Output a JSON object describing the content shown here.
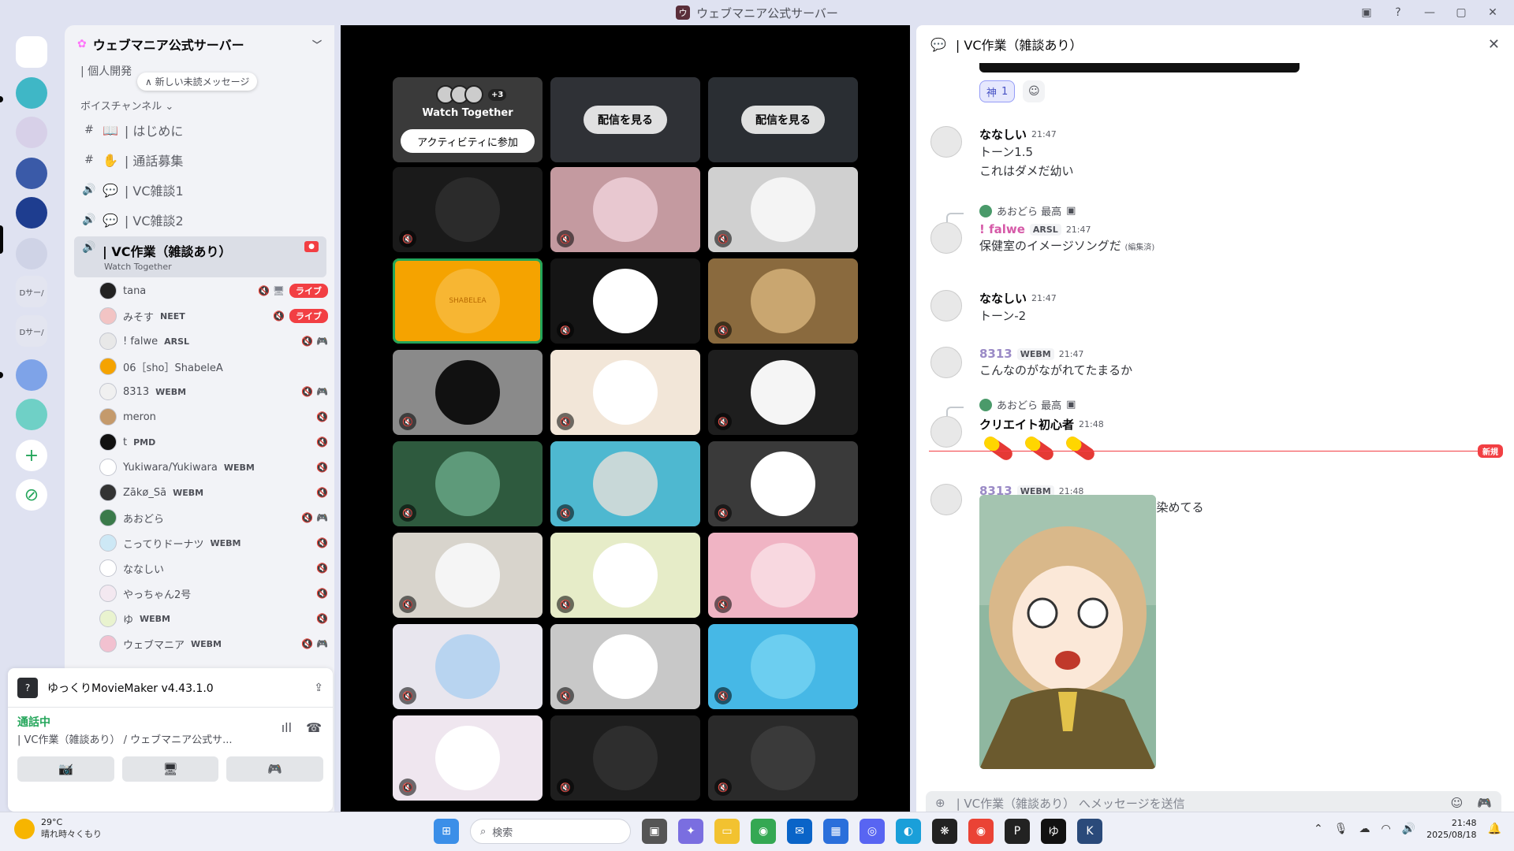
{
  "window": {
    "title": "ウェブマニア公式サーバー",
    "controls": [
      "▣",
      "?",
      "—",
      "▢",
      "✕"
    ]
  },
  "servers": [
    {
      "label": "",
      "type": "discord"
    },
    {
      "label": "",
      "type": "avatar",
      "color": "#3fb7c6"
    },
    {
      "label": "",
      "type": "avatar",
      "color": "#d7d0e8"
    },
    {
      "label": "",
      "type": "avatar",
      "color": "#3a5aa8"
    },
    {
      "label": "",
      "type": "avatar",
      "color": "#1e3d8f"
    },
    {
      "label": "",
      "type": "avatar",
      "color": "#cfd3e6"
    },
    {
      "label": "Dサー/",
      "type": "folder"
    },
    {
      "label": "Dサー/",
      "type": "folder"
    },
    {
      "label": "",
      "type": "avatar",
      "color": "#7ea3e8"
    },
    {
      "label": "",
      "type": "avatar",
      "color": "#6fd0c6"
    },
    {
      "label": "+",
      "type": "add"
    },
    {
      "label": "⊘",
      "type": "discover"
    }
  ],
  "sidebar": {
    "server_name": "ウェブマニア公式サーバー",
    "top_channel": "| 個人開発",
    "new_messages_pill": "∧ 新しい未読メッセージ",
    "category": "ボイスチャンネル",
    "channels": [
      {
        "icon": "#",
        "emoji": "📖",
        "name": "| はじめに"
      },
      {
        "icon": "#",
        "emoji": "✋",
        "name": "| 通話募集"
      },
      {
        "icon": "🔊",
        "emoji": "💬",
        "name": "| VC雑談1"
      },
      {
        "icon": "🔊",
        "emoji": "💬",
        "name": "| VC雑談2"
      }
    ],
    "selected_channel": {
      "icon": "🔊",
      "name": "| VC作業（雑談あり）",
      "sub": "Watch Together"
    },
    "voice_users": [
      {
        "name": "tana",
        "tag": "",
        "live": "ライブ",
        "icons": "🔇 🖥",
        "avatar": "#222"
      },
      {
        "name": "みそす",
        "tag": "NEET",
        "live": "ライブ",
        "icons": "🔇",
        "avatar": "#f2c4c4"
      },
      {
        "name": "! falwe",
        "tag": "ARSL",
        "live": "",
        "icons": "🔇 🎮",
        "avatar": "#e8e8e8"
      },
      {
        "name": "06［sho］ShabeleA",
        "tag": "",
        "live": "",
        "icons": "",
        "avatar": "#f5a300"
      },
      {
        "name": "8313",
        "tag": "WEBM",
        "live": "",
        "icons": "🔇 🎮",
        "avatar": "#f0f0f0"
      },
      {
        "name": "meron",
        "tag": "",
        "live": "",
        "icons": "🔇",
        "avatar": "#c49a6c"
      },
      {
        "name": "t",
        "tag": "PMD",
        "live": "",
        "icons": "🔇",
        "avatar": "#111"
      },
      {
        "name": "Yukiwara/Yukiwara",
        "tag": "WEBM",
        "live": "",
        "icons": "🔇",
        "avatar": "#fff"
      },
      {
        "name": "Zākø_Sā",
        "tag": "WEBM",
        "live": "",
        "icons": "🔇",
        "avatar": "#333"
      },
      {
        "name": "あおどら",
        "tag": "",
        "live": "",
        "icons": "🔇 🎮",
        "avatar": "#3a7a4a"
      },
      {
        "name": "こってりドーナツ",
        "tag": "WEBM",
        "live": "",
        "icons": "🔇",
        "avatar": "#cde8f5"
      },
      {
        "name": "ななしい",
        "tag": "",
        "live": "",
        "icons": "🔇",
        "avatar": "#fff"
      },
      {
        "name": "やっちゃん2号",
        "tag": "",
        "live": "",
        "icons": "🔇",
        "avatar": "#f3e8f0"
      },
      {
        "name": "ゆ",
        "tag": "WEBM",
        "live": "",
        "icons": "🔇",
        "avatar": "#e9f3cf"
      },
      {
        "name": "ウェブマニア",
        "tag": "WEBM",
        "live": "",
        "icons": "🔇 🎮",
        "avatar": "#f2c1d0"
      }
    ]
  },
  "bottom_panel": {
    "activity": "ゆっくりMovieMaker v4.43.1.0",
    "status": "通話中",
    "location": "| VC作業（雑談あり） / ウェブマニア公式サ...",
    "buttons": [
      "📷̸",
      "🖥",
      "🎮"
    ]
  },
  "stage": {
    "watch_together": {
      "title": "Watch Together",
      "more": "+3",
      "button": "アクティビティに参加"
    },
    "stream_button": "配信を見る",
    "tiles": [
      {
        "bg": "#1a1a1a",
        "av": "#2b2b2b",
        "label": ""
      },
      {
        "bg": "#c49aa0",
        "av": "#e8c8d0",
        "label": ""
      },
      {
        "bg": "#d0d0d0",
        "av": "#f4f4f4",
        "label": ""
      },
      {
        "bg": "#f5a300",
        "av": "#f7b633",
        "label": "SHABELEA"
      },
      {
        "bg": "#151515",
        "av": "#ffffff",
        "label": ""
      },
      {
        "bg": "#8a6a3e",
        "av": "#c9a670",
        "label": ""
      },
      {
        "bg": "#8a8a8a",
        "av": "#111111",
        "label": ""
      },
      {
        "bg": "#f2e6d8",
        "av": "#ffffff",
        "label": ""
      },
      {
        "bg": "#1e1e1e",
        "av": "#f5f5f5",
        "label": ""
      },
      {
        "bg": "#2e5a3e",
        "av": "#5e9a7a",
        "label": ""
      },
      {
        "bg": "#4eb8d0",
        "av": "#c8d8d8",
        "label": ""
      },
      {
        "bg": "#3a3a3a",
        "av": "#ffffff",
        "label": ""
      },
      {
        "bg": "#d8d4cc",
        "av": "#f5f5f5",
        "label": ""
      },
      {
        "bg": "#e6ecc8",
        "av": "#ffffff",
        "label": ""
      },
      {
        "bg": "#f0b4c4",
        "av": "#f8d8e0",
        "label": ""
      },
      {
        "bg": "#e8e6ee",
        "av": "#b8d4f0",
        "label": ""
      },
      {
        "bg": "#c8c8c8",
        "av": "#ffffff",
        "label": ""
      },
      {
        "bg": "#46b8e6",
        "av": "#6ccef0",
        "label": ""
      },
      {
        "bg": "#efe6ef",
        "av": "#ffffff",
        "label": ""
      },
      {
        "bg": "#1e1e1e",
        "av": "#2e2e2e",
        "label": ""
      },
      {
        "bg": "#2a2a2a",
        "av": "#3a3a3a",
        "label": ""
      }
    ]
  },
  "chat": {
    "channel": "| VC作業（雑談あり）",
    "reaction": {
      "emoji": "神",
      "count": "1"
    },
    "messages": [
      {
        "name": "ななしい",
        "name_color": "#060607",
        "tag": "",
        "time": "21:47",
        "lines": [
          "トーン1.5",
          "これはダメだ幼い"
        ],
        "reply": ""
      },
      {
        "name": "! falwe",
        "name_color": "#d65aa8",
        "tag": "ARSL",
        "time": "21:47",
        "lines": [
          "保健室のイメージソングだ"
        ],
        "edited": "(編集済)",
        "reply": "あおどら 最高"
      },
      {
        "name": "ななしい",
        "name_color": "#060607",
        "tag": "",
        "time": "21:47",
        "lines": [
          "トーン-2"
        ],
        "reply": ""
      },
      {
        "name": "8313",
        "name_color": "#9a8ac6",
        "tag": "WEBM",
        "time": "21:47",
        "lines": [
          "こんなのがながれてたまるか"
        ],
        "reply": ""
      },
      {
        "name": "クリエイト初心者",
        "name_color": "#060607",
        "tag": "",
        "time": "21:48",
        "lines": [
          ""
        ],
        "reply": "あおどら 最高"
      },
      {
        "name": "8313",
        "name_color": "#9a8ac6",
        "tag": "WEBM",
        "time": "21:48",
        "lines": [
          "ミックルさんいつの間にか髪の毛染めてる"
        ],
        "reply": ""
      }
    ],
    "new_label": "新規",
    "input_placeholder": "| VC作業（雑談あり） へメッセージを送信"
  },
  "taskbar": {
    "weather_temp": "29°C",
    "weather_desc": "晴れ時々くもり",
    "search": "検索",
    "time": "21:48",
    "date": "2025/08/18"
  }
}
